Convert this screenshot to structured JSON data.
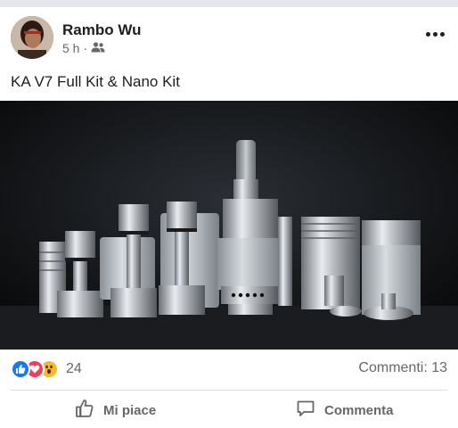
{
  "post": {
    "author": "Rambo Wu",
    "time": "5 h",
    "separator": "·",
    "audience_icon": "friends-icon",
    "text": "KA V7 Full Kit & Nano Kit"
  },
  "reactions": {
    "icons": [
      "like-reaction-icon",
      "love-reaction-icon",
      "wow-reaction-icon"
    ],
    "count": "24",
    "comments": "Commenti: 13"
  },
  "actions": {
    "like_label": "Mi piace",
    "comment_label": "Commenta"
  },
  "colors": {
    "like_blue": "#1877f2",
    "love_red": "#f33e58",
    "wow_yellow": "#f7b928",
    "secondary_text": "#65676b"
  }
}
